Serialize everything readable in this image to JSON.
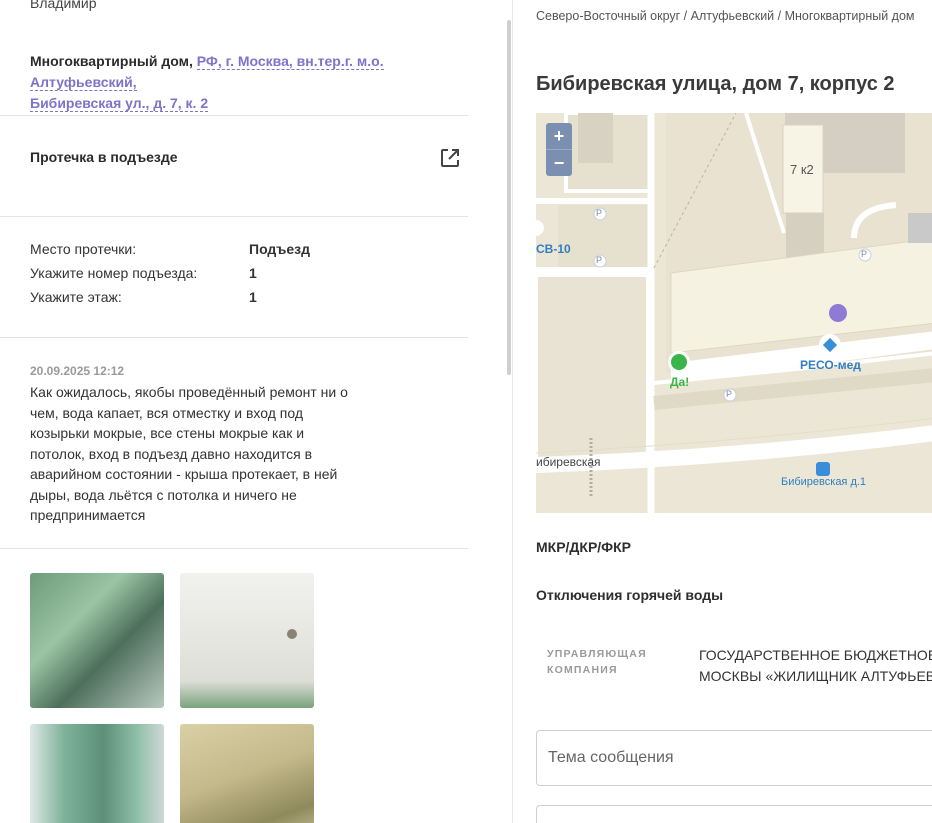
{
  "left": {
    "author": "Владимир",
    "address": {
      "type_label": "Многоквартирный дом,",
      "line1": "РФ, г. Москва, вн.тер.г. м.о. Алтуфьевский,",
      "line2": "Бибиревская ул., д. 7, к. 2"
    },
    "issue_title": "Протечка в подъезде",
    "details": [
      {
        "key": "Место протечки:",
        "value": "Подъезд"
      },
      {
        "key": "Укажите номер подъезда:",
        "value": "1"
      },
      {
        "key": "Укажите этаж:",
        "value": "1"
      }
    ],
    "comment": {
      "date": "20.09.2025 12:12",
      "text": "Как ожидалось, якобы проведённый ремонт ни о чем, вода капает, вся отместку и вход под козырьки мокрые, все стены мокрые как и потолок, вход в подъезд давно находится в аварийном состоянии - крыша протекает, в ней дыры, вода льётся с потолка и ничего не предпринимается"
    }
  },
  "right": {
    "breadcrumb": "Северо-Восточный округ / Алтуфьевский / Многоквартирный дом",
    "title": "Бибиревская улица, дом 7, корпус 2",
    "map": {
      "zoom_in": "+",
      "zoom_out": "−",
      "labels": {
        "building": "7 к2",
        "sv": "СВ-10",
        "shop": "Да!",
        "clinic": "РЕСО-мед",
        "street": "ибиревская",
        "bus_stop": "Бибиревская д.1",
        "parking": "P"
      }
    },
    "sections": {
      "mkr": "МКР/ДКР/ФКР",
      "hot_water": "Отключения горячей воды"
    },
    "management": {
      "label_line1": "УПРАВЛЯЮЩАЯ",
      "label_line2": "КОМПАНИЯ",
      "value_line1": "ГОСУДАРСТВЕННОЕ БЮДЖЕТНОЕ УЧ",
      "value_line2": "МОСКВЫ «ЖИЛИЩНИК АЛТУФЬЕВС"
    },
    "form": {
      "subject_placeholder": "Тема сообщения"
    }
  }
}
